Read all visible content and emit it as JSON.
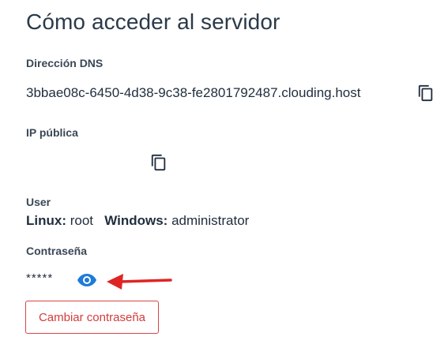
{
  "page": {
    "title": "Cómo acceder al servidor"
  },
  "dns": {
    "label": "Dirección DNS",
    "value": "3bbae08c-6450-4d38-9c38-fe2801792487.clouding.host",
    "copy_icon": "copy-icon"
  },
  "ip": {
    "label": "IP pública",
    "value": "",
    "copy_icon": "copy-icon"
  },
  "user": {
    "label": "User",
    "linux_label": "Linux:",
    "linux_value": "root",
    "windows_label": "Windows:",
    "windows_value": "administrator"
  },
  "password": {
    "label": "Contraseña",
    "masked_value": "*****",
    "reveal_icon": "eye-icon",
    "annotation_icon": "arrow-left-icon"
  },
  "actions": {
    "change_password_label": "Cambiar contraseña"
  },
  "colors": {
    "title": "#2b3a4a",
    "eye_icon": "#1e7bd6",
    "arrow": "#e02424",
    "button_border": "#d64545",
    "button_text": "#d23c3c"
  }
}
